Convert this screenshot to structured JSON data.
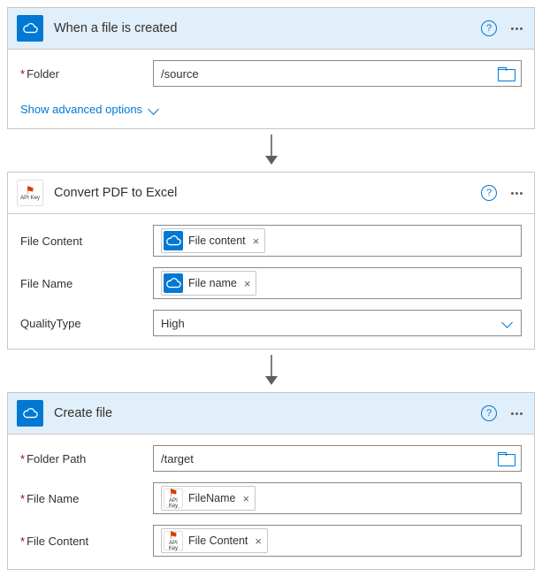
{
  "card1": {
    "title": "When a file is created",
    "folder_label": "Folder",
    "folder_value": "/source",
    "advanced": "Show advanced options"
  },
  "card2": {
    "title": "Convert PDF to Excel",
    "icon_caption": "API Key",
    "fc_label": "File Content",
    "fc_token": "File content",
    "fn_label": "File Name",
    "fn_token": "File name",
    "qt_label": "QualityType",
    "qt_value": "High"
  },
  "card3": {
    "title": "Create file",
    "fp_label": "Folder Path",
    "fp_value": "/target",
    "fn2_label": "File Name",
    "fn2_token": "FileName",
    "fc2_label": "File Content",
    "fc2_token": "File Content",
    "token_caption": "API Key"
  },
  "glyphs": {
    "help": "?",
    "x": "×"
  }
}
